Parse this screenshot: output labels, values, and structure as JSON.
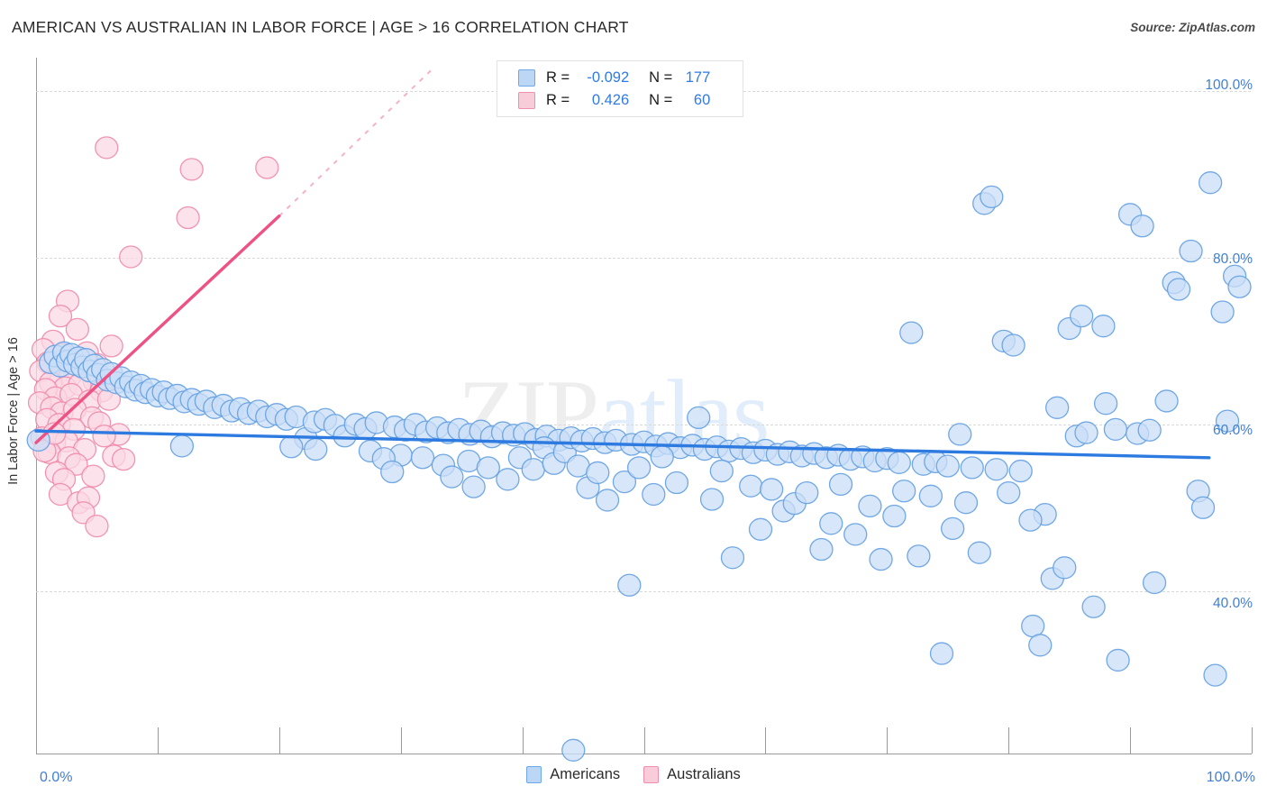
{
  "header": {
    "title": "AMERICAN VS AUSTRALIAN IN LABOR FORCE | AGE > 16 CORRELATION CHART",
    "source": "Source: ZipAtlas.com"
  },
  "watermark": {
    "part1": "ZIP",
    "part2": "atlas"
  },
  "stats": {
    "rows": [
      {
        "series": "Americans",
        "r_key": "R =",
        "r_value": "-0.092",
        "n_key": "N =",
        "n_value": "177",
        "color": "#bcd6f5"
      },
      {
        "series": "Australians",
        "r_key": "R =",
        "r_value": "0.426",
        "n_key": "N =",
        "n_value": "60",
        "color": "#f9ccda"
      }
    ]
  },
  "legend": {
    "items": [
      {
        "label": "Americans",
        "color": "#bcd6f5"
      },
      {
        "label": "Australians",
        "color": "#f9ccda"
      }
    ]
  },
  "axes": {
    "y_title": "In Labor Force | Age > 16",
    "y_ticks": [
      "100.0%",
      "80.0%",
      "60.0%",
      "40.0%"
    ],
    "x_min_label": "0.0%",
    "x_max_label": "100.0%"
  },
  "chart_data": {
    "type": "scatter",
    "title": "AMERICAN VS AUSTRALIAN IN LABOR FORCE | AGE > 16 CORRELATION CHART",
    "xlabel": "",
    "ylabel": "In Labor Force | Age > 16",
    "xlim": [
      0,
      100
    ],
    "ylim": [
      20.5,
      104.0
    ],
    "x_ticks": [
      0,
      100
    ],
    "y_ticks": [
      40,
      60,
      80,
      100
    ],
    "grid": true,
    "legend_position": "bottom-center",
    "colors": {
      "americans_fill": "#c9ddf7",
      "americans_stroke": "#63a0e2",
      "australians_fill": "#fbd8e3",
      "australians_stroke": "#f08aab",
      "americans_trend": "#2d7ae0",
      "australians_trend": "#ee5285",
      "axis_label": "#3f7fd4"
    },
    "series": [
      {
        "name": "Americans",
        "r": -0.092,
        "n": 177,
        "trendline": {
          "x0": 0,
          "y0": 59.2,
          "x1": 96.5,
          "y1": 56.0
        },
        "points": [
          [
            0.2,
            58.1
          ],
          [
            1.2,
            67.4
          ],
          [
            1.6,
            68.2
          ],
          [
            2.0,
            67.0
          ],
          [
            2.3,
            68.6
          ],
          [
            2.6,
            67.6
          ],
          [
            2.9,
            68.4
          ],
          [
            3.2,
            67.2
          ],
          [
            3.5,
            68.0
          ],
          [
            3.8,
            66.9
          ],
          [
            4.1,
            67.8
          ],
          [
            4.4,
            66.4
          ],
          [
            4.8,
            67.1
          ],
          [
            5.1,
            66.0
          ],
          [
            5.5,
            66.6
          ],
          [
            5.9,
            65.3
          ],
          [
            6.2,
            66.1
          ],
          [
            6.6,
            65.0
          ],
          [
            7.0,
            65.6
          ],
          [
            7.4,
            64.5
          ],
          [
            7.8,
            65.1
          ],
          [
            8.2,
            64.1
          ],
          [
            8.6,
            64.7
          ],
          [
            9.0,
            63.8
          ],
          [
            9.5,
            64.2
          ],
          [
            10.0,
            63.4
          ],
          [
            10.5,
            63.9
          ],
          [
            11.0,
            63.1
          ],
          [
            11.6,
            63.5
          ],
          [
            12.2,
            62.7
          ],
          [
            12.8,
            63.0
          ],
          [
            13.4,
            62.4
          ],
          [
            14.0,
            62.8
          ],
          [
            14.7,
            62.0
          ],
          [
            15.4,
            62.3
          ],
          [
            16.1,
            61.6
          ],
          [
            16.8,
            61.9
          ],
          [
            17.5,
            61.3
          ],
          [
            18.3,
            61.6
          ],
          [
            19.0,
            60.9
          ],
          [
            19.8,
            61.2
          ],
          [
            20.6,
            60.6
          ],
          [
            21.4,
            60.9
          ],
          [
            22.2,
            58.3
          ],
          [
            22.9,
            60.3
          ],
          [
            23.8,
            60.6
          ],
          [
            24.6,
            59.9
          ],
          [
            25.4,
            58.6
          ],
          [
            26.3,
            60.0
          ],
          [
            27.1,
            59.5
          ],
          [
            28.0,
            60.2
          ],
          [
            21.0,
            57.3
          ],
          [
            23.0,
            57.0
          ],
          [
            27.5,
            56.8
          ],
          [
            29.5,
            59.7
          ],
          [
            30.4,
            59.3
          ],
          [
            31.2,
            60.0
          ],
          [
            32.1,
            59.1
          ],
          [
            33.0,
            59.6
          ],
          [
            33.9,
            59.0
          ],
          [
            34.8,
            59.4
          ],
          [
            35.7,
            58.8
          ],
          [
            36.6,
            59.2
          ],
          [
            37.5,
            58.5
          ],
          [
            38.4,
            59.0
          ],
          [
            30.0,
            56.3
          ],
          [
            31.8,
            56.0
          ],
          [
            28.6,
            55.9
          ],
          [
            29.3,
            54.3
          ],
          [
            33.5,
            55.1
          ],
          [
            34.2,
            53.7
          ],
          [
            35.6,
            55.6
          ],
          [
            36.0,
            52.5
          ],
          [
            37.2,
            54.8
          ],
          [
            38.8,
            53.4
          ],
          [
            39.3,
            58.7
          ],
          [
            40.2,
            58.9
          ],
          [
            41.1,
            58.2
          ],
          [
            42.0,
            58.6
          ],
          [
            43.0,
            58.1
          ],
          [
            39.8,
            56.0
          ],
          [
            40.9,
            54.6
          ],
          [
            41.8,
            57.2
          ],
          [
            42.6,
            55.3
          ],
          [
            43.5,
            56.7
          ],
          [
            44.0,
            58.4
          ],
          [
            44.9,
            58.0
          ],
          [
            45.8,
            58.3
          ],
          [
            46.8,
            57.8
          ],
          [
            47.7,
            58.1
          ],
          [
            44.6,
            55.0
          ],
          [
            45.4,
            52.4
          ],
          [
            46.2,
            54.2
          ],
          [
            47.0,
            50.9
          ],
          [
            48.4,
            53.1
          ],
          [
            49.0,
            57.6
          ],
          [
            50.0,
            57.9
          ],
          [
            51.0,
            57.4
          ],
          [
            52.0,
            57.7
          ],
          [
            53.0,
            57.2
          ],
          [
            48.8,
            40.7
          ],
          [
            49.6,
            54.8
          ],
          [
            50.8,
            51.6
          ],
          [
            51.5,
            56.1
          ],
          [
            52.7,
            53.0
          ],
          [
            54.0,
            57.5
          ],
          [
            55.0,
            57.0
          ],
          [
            56.0,
            57.3
          ],
          [
            57.0,
            56.8
          ],
          [
            58.0,
            57.1
          ],
          [
            54.5,
            60.8
          ],
          [
            55.6,
            51.0
          ],
          [
            56.4,
            54.4
          ],
          [
            57.3,
            44.0
          ],
          [
            58.8,
            52.6
          ],
          [
            59.0,
            56.6
          ],
          [
            60.0,
            56.9
          ],
          [
            61.0,
            56.4
          ],
          [
            62.0,
            56.7
          ],
          [
            63.0,
            56.2
          ],
          [
            59.6,
            47.4
          ],
          [
            60.5,
            52.2
          ],
          [
            61.5,
            49.6
          ],
          [
            62.4,
            50.5
          ],
          [
            63.4,
            51.8
          ],
          [
            64.0,
            56.5
          ],
          [
            65.0,
            56.0
          ],
          [
            66.0,
            56.3
          ],
          [
            67.0,
            55.8
          ],
          [
            68.0,
            56.1
          ],
          [
            64.6,
            45.0
          ],
          [
            65.4,
            48.1
          ],
          [
            66.2,
            52.8
          ],
          [
            67.4,
            46.8
          ],
          [
            68.6,
            50.2
          ],
          [
            69.0,
            55.6
          ],
          [
            70.0,
            55.9
          ],
          [
            71.0,
            55.4
          ],
          [
            72.0,
            71.0
          ],
          [
            73.0,
            55.2
          ],
          [
            69.5,
            43.8
          ],
          [
            70.6,
            49.0
          ],
          [
            71.4,
            52.0
          ],
          [
            72.6,
            44.2
          ],
          [
            73.6,
            51.4
          ],
          [
            74.0,
            55.5
          ],
          [
            75.0,
            55.0
          ],
          [
            76.0,
            58.8
          ],
          [
            77.0,
            54.8
          ],
          [
            78.0,
            86.5
          ],
          [
            74.5,
            32.5
          ],
          [
            75.4,
            47.5
          ],
          [
            76.5,
            50.6
          ],
          [
            77.6,
            44.6
          ],
          [
            78.6,
            87.3
          ],
          [
            79.0,
            54.6
          ],
          [
            80.0,
            51.8
          ],
          [
            81.0,
            54.4
          ],
          [
            82.0,
            35.8
          ],
          [
            83.0,
            49.2
          ],
          [
            79.6,
            70.0
          ],
          [
            80.4,
            69.5
          ],
          [
            81.8,
            48.5
          ],
          [
            82.6,
            33.5
          ],
          [
            83.6,
            41.5
          ],
          [
            84.0,
            62.0
          ],
          [
            85.0,
            71.5
          ],
          [
            86.0,
            73.0
          ],
          [
            87.0,
            38.1
          ],
          [
            88.0,
            62.5
          ],
          [
            84.6,
            42.8
          ],
          [
            85.6,
            58.6
          ],
          [
            86.4,
            59.0
          ],
          [
            87.8,
            71.8
          ],
          [
            88.8,
            59.4
          ],
          [
            89.0,
            31.7
          ],
          [
            90.0,
            85.2
          ],
          [
            91.0,
            83.8
          ],
          [
            92.0,
            41.0
          ],
          [
            93.0,
            62.8
          ],
          [
            90.6,
            58.9
          ],
          [
            91.6,
            59.3
          ],
          [
            93.6,
            77.0
          ],
          [
            94.0,
            76.2
          ],
          [
            95.0,
            80.8
          ],
          [
            95.6,
            52.0
          ],
          [
            96.0,
            50.0
          ],
          [
            96.6,
            89.0
          ],
          [
            97.0,
            29.9
          ],
          [
            97.6,
            73.5
          ],
          [
            98.0,
            60.4
          ],
          [
            98.6,
            77.8
          ],
          [
            99.0,
            76.5
          ],
          [
            44.2,
            20.9
          ],
          [
            12.0,
            57.4
          ]
        ]
      },
      {
        "name": "Australians",
        "r": 0.426,
        "n": 60,
        "trendline": {
          "x0": 0,
          "y0": 57.8,
          "x1": 20.0,
          "y1": 85.0
        },
        "trendline_extension": {
          "x0": 20.0,
          "y0": 85.0,
          "x1": 32.5,
          "y1": 102.5
        },
        "points": [
          [
            5.8,
            93.2
          ],
          [
            12.8,
            90.6
          ],
          [
            19.0,
            90.8
          ],
          [
            12.5,
            84.8
          ],
          [
            7.8,
            80.1
          ],
          [
            2.6,
            74.8
          ],
          [
            2.0,
            73.0
          ],
          [
            3.4,
            71.4
          ],
          [
            1.4,
            70.0
          ],
          [
            0.6,
            69.0
          ],
          [
            2.2,
            68.4
          ],
          [
            3.0,
            67.6
          ],
          [
            4.2,
            68.6
          ],
          [
            5.0,
            67.2
          ],
          [
            6.2,
            69.4
          ],
          [
            1.0,
            67.4
          ],
          [
            1.8,
            66.2
          ],
          [
            2.8,
            65.8
          ],
          [
            3.8,
            66.8
          ],
          [
            4.8,
            65.2
          ],
          [
            0.4,
            66.4
          ],
          [
            1.2,
            65.0
          ],
          [
            2.4,
            64.4
          ],
          [
            3.6,
            64.8
          ],
          [
            5.4,
            64.0
          ],
          [
            0.8,
            64.2
          ],
          [
            1.6,
            63.2
          ],
          [
            2.9,
            63.6
          ],
          [
            4.4,
            62.8
          ],
          [
            6.0,
            63.0
          ],
          [
            0.3,
            62.6
          ],
          [
            1.3,
            62.0
          ],
          [
            2.1,
            61.4
          ],
          [
            3.2,
            61.8
          ],
          [
            4.6,
            60.8
          ],
          [
            0.9,
            60.6
          ],
          [
            1.9,
            60.0
          ],
          [
            3.1,
            59.4
          ],
          [
            5.2,
            60.2
          ],
          [
            6.8,
            58.8
          ],
          [
            0.5,
            58.4
          ],
          [
            1.5,
            57.8
          ],
          [
            2.5,
            58.0
          ],
          [
            4.0,
            57.0
          ],
          [
            5.6,
            58.6
          ],
          [
            1.1,
            56.6
          ],
          [
            2.7,
            56.0
          ],
          [
            3.3,
            55.2
          ],
          [
            6.4,
            56.2
          ],
          [
            7.2,
            55.8
          ],
          [
            1.7,
            54.2
          ],
          [
            2.3,
            53.4
          ],
          [
            4.7,
            53.8
          ],
          [
            0.7,
            56.8
          ],
          [
            2.0,
            51.6
          ],
          [
            3.5,
            50.6
          ],
          [
            4.3,
            51.2
          ],
          [
            3.9,
            49.4
          ],
          [
            5.0,
            47.8
          ],
          [
            1.5,
            58.9
          ]
        ]
      }
    ]
  }
}
